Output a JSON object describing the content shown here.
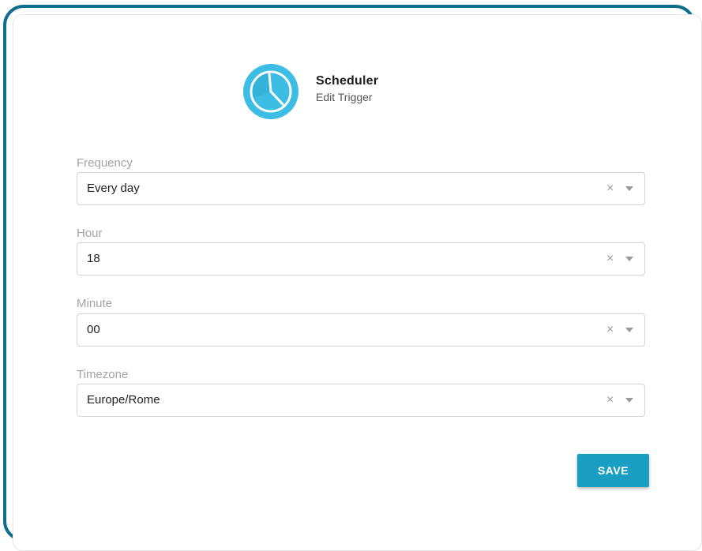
{
  "header": {
    "title": "Scheduler",
    "subtitle": "Edit Trigger",
    "icon": "clock-icon"
  },
  "fields": [
    {
      "label": "Frequency",
      "value": "Every day"
    },
    {
      "label": "Hour",
      "value": "18"
    },
    {
      "label": "Minute",
      "value": "00"
    },
    {
      "label": "Timezone",
      "value": "Europe/Rome"
    }
  ],
  "actions": {
    "save_label": "SAVE"
  },
  "colors": {
    "frame_border": "#0d6d8c",
    "accent": "#1a9fc2",
    "icon_bg": "#3cbde3"
  }
}
